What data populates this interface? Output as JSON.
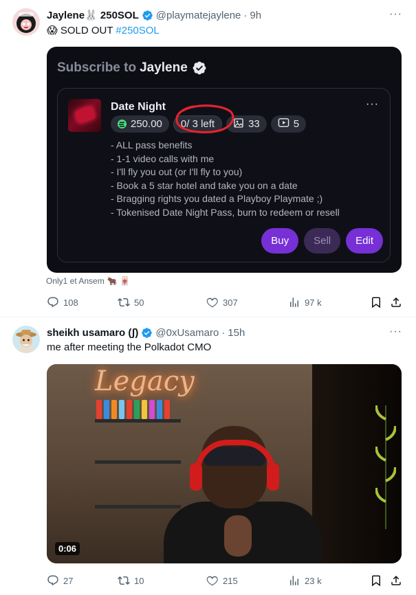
{
  "tweets": [
    {
      "author_name": "Jaylene🐰 250SOL",
      "handle": "@playmatejaylene",
      "separator": "·",
      "time": "9h",
      "more": "···",
      "text_emoji": "😱",
      "text_main": "SOLD OUT",
      "hashtag": "#250SOL",
      "card": {
        "subscribe_label": "Subscribe to",
        "creator_name": "Jaylene",
        "pass_name": "Date Night",
        "price": "250.00",
        "remaining": "0/ 3 left",
        "images_count": "33",
        "videos_count": "5",
        "more": "···",
        "benefits": [
          "- ALL pass benefits",
          "- 1-1 video calls with me",
          "- I'll fly you out (or I'll fly to you)",
          "- Book a 5 star hotel and take you on a date",
          "- Bragging rights you dated a Playboy Playmate ;)",
          "- Tokenised Date Night Pass, burn to redeem or resell"
        ],
        "buttons": {
          "buy": "Buy",
          "sell": "Sell",
          "edit": "Edit"
        }
      },
      "liked_by": "Only1 et Ansem",
      "liked_by_emoji": "🐂 🀄",
      "stats": {
        "replies": "108",
        "retweets": "50",
        "likes": "307",
        "views": "97 k"
      }
    },
    {
      "author_name": "sheikh usamaro (ʃ)",
      "handle": "@0xUsamaro",
      "separator": "·",
      "time": "15h",
      "more": "···",
      "text": "me after meeting the Polkadot CMO",
      "video": {
        "neon_sign": "Legacy",
        "duration": "0:06"
      },
      "stats": {
        "replies": "27",
        "retweets": "10",
        "likes": "215",
        "views": "23 k"
      }
    }
  ],
  "colors": {
    "accent_blue": "#1d9bf0",
    "purple_button": "#7630d6",
    "card_bg": "#0d0e14",
    "highlight_red": "#e0242f"
  },
  "icons": [
    "verified-badge-icon",
    "reply-icon",
    "retweet-icon",
    "like-icon",
    "views-icon",
    "bookmark-icon",
    "share-icon",
    "solana-icon",
    "image-icon",
    "video-icon"
  ]
}
